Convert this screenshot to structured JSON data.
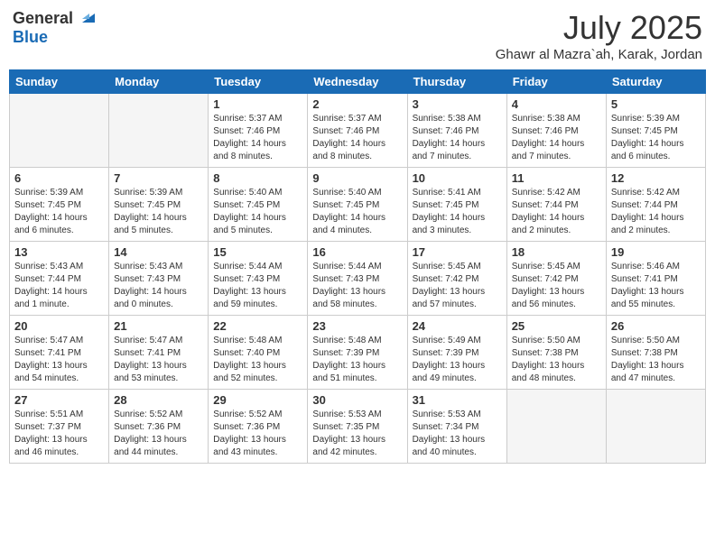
{
  "header": {
    "logo_line1": "General",
    "logo_line2": "Blue",
    "month": "July 2025",
    "location": "Ghawr al Mazra`ah, Karak, Jordan"
  },
  "weekdays": [
    "Sunday",
    "Monday",
    "Tuesday",
    "Wednesday",
    "Thursday",
    "Friday",
    "Saturday"
  ],
  "weeks": [
    [
      {
        "day": "",
        "empty": true
      },
      {
        "day": "",
        "empty": true
      },
      {
        "day": "1",
        "sunrise": "5:37 AM",
        "sunset": "7:46 PM",
        "daylight": "14 hours and 8 minutes."
      },
      {
        "day": "2",
        "sunrise": "5:37 AM",
        "sunset": "7:46 PM",
        "daylight": "14 hours and 8 minutes."
      },
      {
        "day": "3",
        "sunrise": "5:38 AM",
        "sunset": "7:46 PM",
        "daylight": "14 hours and 7 minutes."
      },
      {
        "day": "4",
        "sunrise": "5:38 AM",
        "sunset": "7:46 PM",
        "daylight": "14 hours and 7 minutes."
      },
      {
        "day": "5",
        "sunrise": "5:39 AM",
        "sunset": "7:45 PM",
        "daylight": "14 hours and 6 minutes."
      }
    ],
    [
      {
        "day": "6",
        "sunrise": "5:39 AM",
        "sunset": "7:45 PM",
        "daylight": "14 hours and 6 minutes."
      },
      {
        "day": "7",
        "sunrise": "5:39 AM",
        "sunset": "7:45 PM",
        "daylight": "14 hours and 5 minutes."
      },
      {
        "day": "8",
        "sunrise": "5:40 AM",
        "sunset": "7:45 PM",
        "daylight": "14 hours and 5 minutes."
      },
      {
        "day": "9",
        "sunrise": "5:40 AM",
        "sunset": "7:45 PM",
        "daylight": "14 hours and 4 minutes."
      },
      {
        "day": "10",
        "sunrise": "5:41 AM",
        "sunset": "7:45 PM",
        "daylight": "14 hours and 3 minutes."
      },
      {
        "day": "11",
        "sunrise": "5:42 AM",
        "sunset": "7:44 PM",
        "daylight": "14 hours and 2 minutes."
      },
      {
        "day": "12",
        "sunrise": "5:42 AM",
        "sunset": "7:44 PM",
        "daylight": "14 hours and 2 minutes."
      }
    ],
    [
      {
        "day": "13",
        "sunrise": "5:43 AM",
        "sunset": "7:44 PM",
        "daylight": "14 hours and 1 minute."
      },
      {
        "day": "14",
        "sunrise": "5:43 AM",
        "sunset": "7:43 PM",
        "daylight": "14 hours and 0 minutes."
      },
      {
        "day": "15",
        "sunrise": "5:44 AM",
        "sunset": "7:43 PM",
        "daylight": "13 hours and 59 minutes."
      },
      {
        "day": "16",
        "sunrise": "5:44 AM",
        "sunset": "7:43 PM",
        "daylight": "13 hours and 58 minutes."
      },
      {
        "day": "17",
        "sunrise": "5:45 AM",
        "sunset": "7:42 PM",
        "daylight": "13 hours and 57 minutes."
      },
      {
        "day": "18",
        "sunrise": "5:45 AM",
        "sunset": "7:42 PM",
        "daylight": "13 hours and 56 minutes."
      },
      {
        "day": "19",
        "sunrise": "5:46 AM",
        "sunset": "7:41 PM",
        "daylight": "13 hours and 55 minutes."
      }
    ],
    [
      {
        "day": "20",
        "sunrise": "5:47 AM",
        "sunset": "7:41 PM",
        "daylight": "13 hours and 54 minutes."
      },
      {
        "day": "21",
        "sunrise": "5:47 AM",
        "sunset": "7:41 PM",
        "daylight": "13 hours and 53 minutes."
      },
      {
        "day": "22",
        "sunrise": "5:48 AM",
        "sunset": "7:40 PM",
        "daylight": "13 hours and 52 minutes."
      },
      {
        "day": "23",
        "sunrise": "5:48 AM",
        "sunset": "7:39 PM",
        "daylight": "13 hours and 51 minutes."
      },
      {
        "day": "24",
        "sunrise": "5:49 AM",
        "sunset": "7:39 PM",
        "daylight": "13 hours and 49 minutes."
      },
      {
        "day": "25",
        "sunrise": "5:50 AM",
        "sunset": "7:38 PM",
        "daylight": "13 hours and 48 minutes."
      },
      {
        "day": "26",
        "sunrise": "5:50 AM",
        "sunset": "7:38 PM",
        "daylight": "13 hours and 47 minutes."
      }
    ],
    [
      {
        "day": "27",
        "sunrise": "5:51 AM",
        "sunset": "7:37 PM",
        "daylight": "13 hours and 46 minutes."
      },
      {
        "day": "28",
        "sunrise": "5:52 AM",
        "sunset": "7:36 PM",
        "daylight": "13 hours and 44 minutes."
      },
      {
        "day": "29",
        "sunrise": "5:52 AM",
        "sunset": "7:36 PM",
        "daylight": "13 hours and 43 minutes."
      },
      {
        "day": "30",
        "sunrise": "5:53 AM",
        "sunset": "7:35 PM",
        "daylight": "13 hours and 42 minutes."
      },
      {
        "day": "31",
        "sunrise": "5:53 AM",
        "sunset": "7:34 PM",
        "daylight": "13 hours and 40 minutes."
      },
      {
        "day": "",
        "empty": true
      },
      {
        "day": "",
        "empty": true
      }
    ]
  ]
}
